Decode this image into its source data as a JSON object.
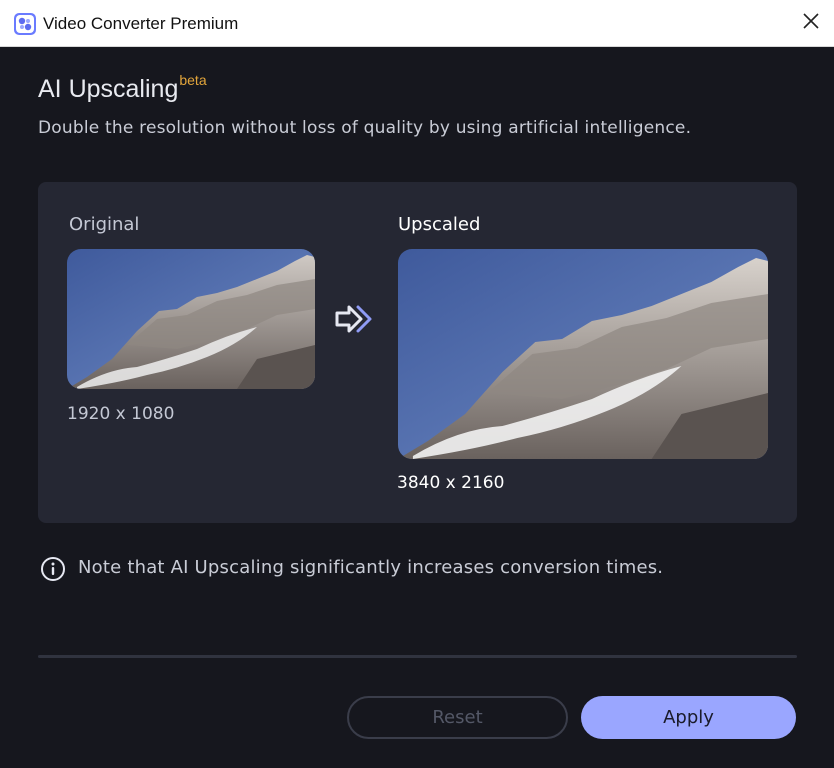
{
  "window": {
    "title": "Video Converter Premium",
    "app_icon": "video-converter-app-icon",
    "close_icon": "close-icon"
  },
  "header": {
    "title": "AI Upscaling",
    "badge": "beta",
    "subtitle": "Double the resolution without loss of quality by using artificial intelligence."
  },
  "comparison": {
    "original": {
      "label": "Original",
      "resolution": "1920 x 1080",
      "image": "mountain-landscape-thumbnail"
    },
    "arrow_icon": "double-arrow-right-icon",
    "upscaled": {
      "label": "Upscaled",
      "resolution": "3840 x 2160",
      "image": "mountain-landscape-preview"
    }
  },
  "note": {
    "icon": "info-icon",
    "text": "Note that AI Upscaling significantly increases conversion times."
  },
  "buttons": {
    "reset_label": "Reset",
    "apply_label": "Apply"
  },
  "colors": {
    "background": "#16171e",
    "panel": "#252733",
    "accent": "#9aa6ff",
    "beta_badge": "#e2a53b"
  }
}
